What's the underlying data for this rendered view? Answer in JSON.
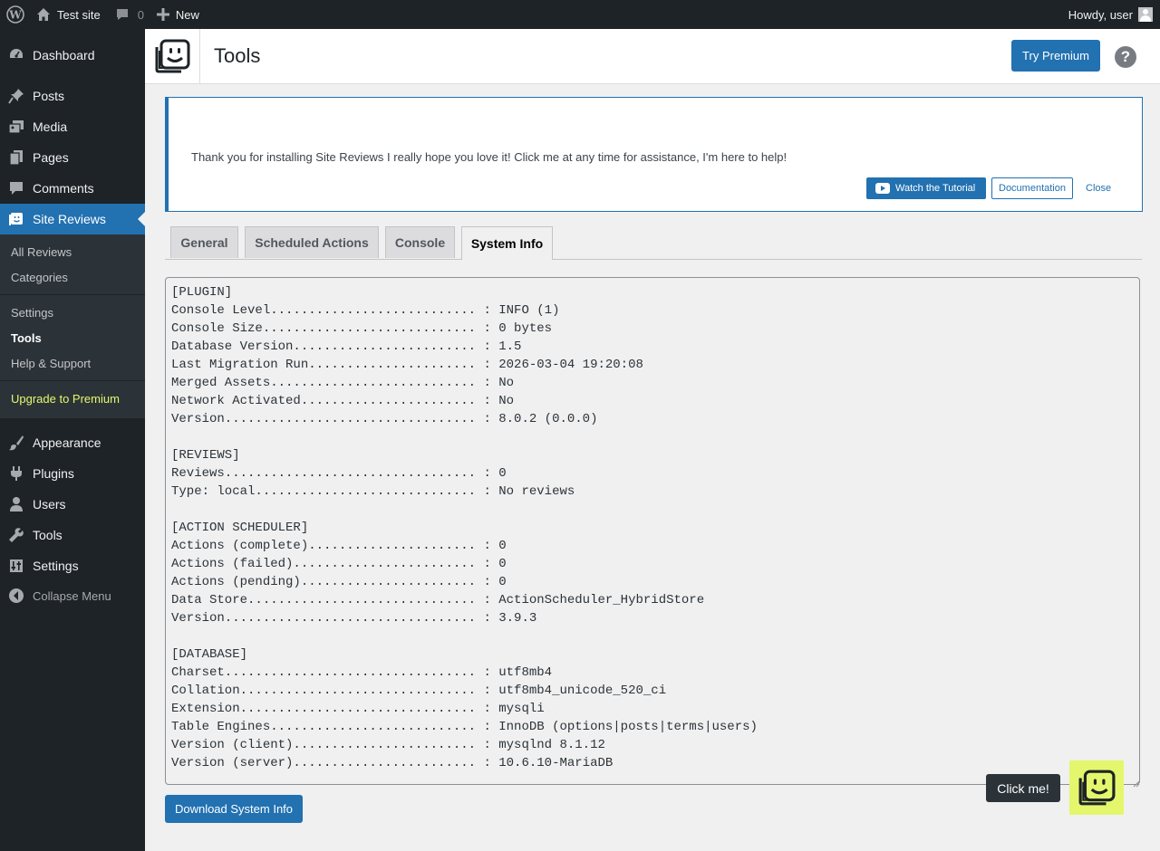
{
  "adminbar": {
    "site_name": "Test site",
    "comments_count": "0",
    "new_label": "New",
    "howdy": "Howdy, user"
  },
  "sidebar": {
    "items": [
      {
        "label": "Dashboard",
        "icon": "dashboard-icon"
      },
      {
        "label": "Posts",
        "icon": "pushpin-icon"
      },
      {
        "label": "Media",
        "icon": "media-icon"
      },
      {
        "label": "Pages",
        "icon": "pages-icon"
      },
      {
        "label": "Comments",
        "icon": "comment-icon"
      },
      {
        "label": "Site Reviews",
        "icon": "site-reviews-icon"
      },
      {
        "label": "Appearance",
        "icon": "paintbrush-icon"
      },
      {
        "label": "Plugins",
        "icon": "plugin-icon"
      },
      {
        "label": "Users",
        "icon": "user-icon"
      },
      {
        "label": "Tools",
        "icon": "wrench-icon"
      },
      {
        "label": "Settings",
        "icon": "settings-icon"
      }
    ],
    "submenu": [
      "All Reviews",
      "Categories",
      "Settings",
      "Tools",
      "Help & Support",
      "Upgrade to Premium"
    ],
    "collapse_label": "Collapse Menu"
  },
  "header": {
    "title": "Tools",
    "premium_button": "Try Premium",
    "help": "?"
  },
  "notice": {
    "message": "Thank you for installing Site Reviews I really hope you love it! Click me at any time for assistance, I'm here to help!",
    "tutorial_button": "Watch the Tutorial",
    "docs_button": "Documentation",
    "close_link": "Close"
  },
  "tabs": [
    "General",
    "Scheduled Actions",
    "Console",
    "System Info"
  ],
  "active_tab": "System Info",
  "system_info": "[PLUGIN]\nConsole Level........................... : INFO (1)\nConsole Size............................ : 0 bytes\nDatabase Version........................ : 1.5\nLast Migration Run...................... : 2026-03-04 19:20:08\nMerged Assets........................... : No\nNetwork Activated....................... : No\nVersion................................. : 8.0.2 (0.0.0)\n\n[REVIEWS]\nReviews................................. : 0\nType: local............................. : No reviews\n\n[ACTION SCHEDULER]\nActions (complete)...................... : 0\nActions (failed)........................ : 0\nActions (pending)....................... : 0\nData Store.............................. : ActionScheduler_HybridStore\nVersion................................. : 3.9.3\n\n[DATABASE]\nCharset................................. : utf8mb4\nCollation............................... : utf8mb4_unicode_520_ci\nExtension............................... : mysqli\nTable Engines........................... : InnoDB (options|posts|terms|users)\nVersion (client)........................ : mysqlnd 8.1.12\nVersion (server)........................ : 10.6.10-MariaDB",
  "download_button": "Download System Info",
  "helper_tooltip": "Click me!",
  "colors": {
    "admin_dark": "#1d2327",
    "submenu_bg": "#2c3338",
    "accent_blue": "#2271b1",
    "premium_yellow": "#e4f76c",
    "page_bg": "#f0f0f1"
  }
}
